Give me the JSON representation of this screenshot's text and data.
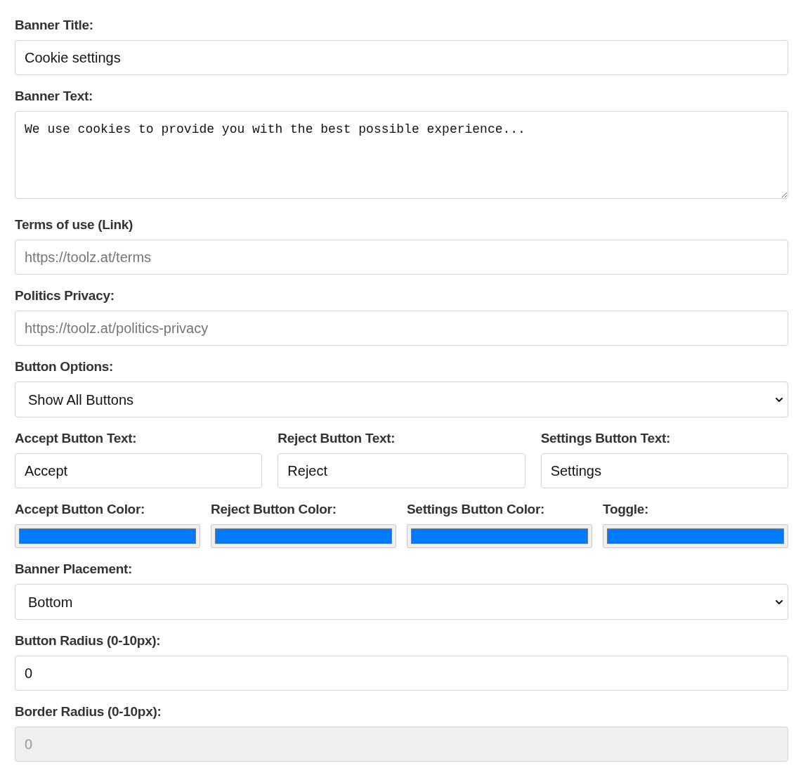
{
  "fields": [
    {
      "kind": "input",
      "label": "Banner Title:",
      "value": "Cookie settings",
      "disabled": false
    },
    {
      "kind": "textarea",
      "label": "Banner Text:",
      "value": "We use cookies to provide you with the best possible experience..."
    },
    {
      "kind": "input",
      "label": "Terms of use (Link)",
      "placeholder": "https://toolz.at/terms",
      "disabled": false
    },
    {
      "kind": "input",
      "label": "Politics Privacy:",
      "placeholder": "https://toolz.at/politics-privacy",
      "disabled": false
    },
    {
      "kind": "select",
      "label": "Button Options:",
      "value": "Show All Buttons"
    },
    {
      "kind": "row",
      "items": [
        {
          "label": "Accept Button Text:",
          "value": "Accept"
        },
        {
          "label": "Reject Button Text:",
          "value": "Reject"
        },
        {
          "label": "Settings Button Text:",
          "value": "Settings"
        }
      ]
    },
    {
      "kind": "colors",
      "items": [
        {
          "label": "Accept Button Color:",
          "color": "#007bff"
        },
        {
          "label": "Reject Button Color:",
          "color": "#007bff"
        },
        {
          "label": "Settings Button Color:",
          "color": "#007bff"
        },
        {
          "label": "Toggle:",
          "color": "#007bff"
        }
      ]
    },
    {
      "kind": "select",
      "label": "Banner Placement:",
      "value": "Bottom"
    },
    {
      "kind": "input",
      "label": "Button Radius (0-10px):",
      "value": "0",
      "disabled": false
    },
    {
      "kind": "input",
      "label": "Border Radius (0-10px):",
      "value": "0",
      "disabled": true
    }
  ]
}
